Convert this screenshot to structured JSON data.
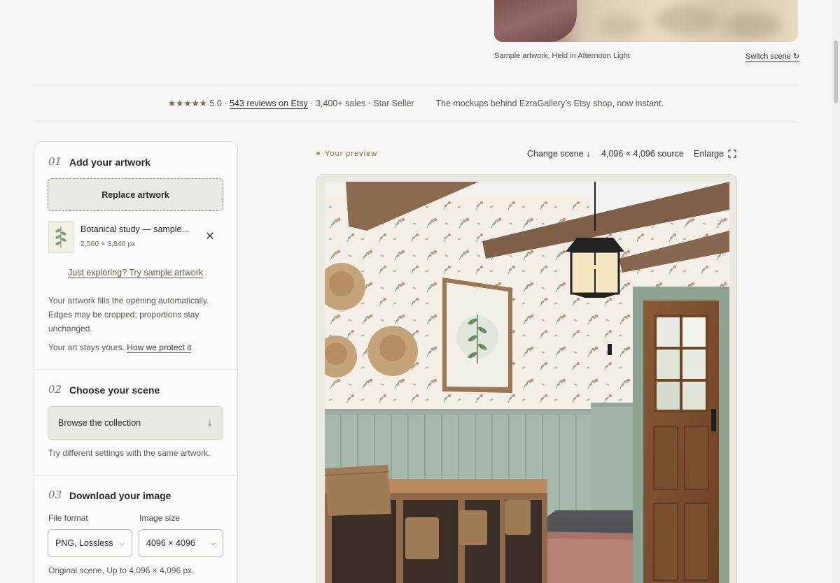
{
  "hero": {
    "caption": "Sample artwork, Held in Afternoon Light",
    "switch_label": "Switch scene ↻"
  },
  "trust": {
    "stars": "★★★★★",
    "rating": "5.0 ·",
    "reviews_link": "543 reviews on Etsy",
    "stats": "· 3,400+ sales · Star Seller",
    "tagline": "The mockups behind EzraGallery’s Etsy shop, now instant."
  },
  "steps": {
    "add": {
      "number": "01",
      "title": "Add your artwork",
      "replace_label": "Replace artwork",
      "file_name": "Botanical study — sample...",
      "file_dims": "2,560 × 3,840 px",
      "remove_icon": "close-icon",
      "sample_link": "Just exploring? Try sample artwork",
      "help_text": "Your artwork fills the opening automatically. Edges may be cropped; proportions stay unchanged.",
      "privacy_prefix": "Your art stays yours.",
      "privacy_link": "How we protect it"
    },
    "scene": {
      "number": "02",
      "title": "Choose your scene",
      "browse_label": "Browse the collection",
      "hint": "Try different settings with the same artwork."
    },
    "download": {
      "number": "03",
      "title": "Download your image",
      "format_label": "File format",
      "format_value": "PNG, Lossless",
      "size_label": "Image size",
      "size_value": "4096 × 4096",
      "note": "Original scene, Up to 4,096 × 4,096 px."
    }
  },
  "preview": {
    "label": "Your preview",
    "change_scene": "Change scene ↓",
    "source": "4,096 × 4,096 source",
    "enlarge": "Enlarge"
  },
  "colors": {
    "accent": "#8a6d3c",
    "background": "#f8f6f2",
    "panel": "#fdfcfa"
  }
}
